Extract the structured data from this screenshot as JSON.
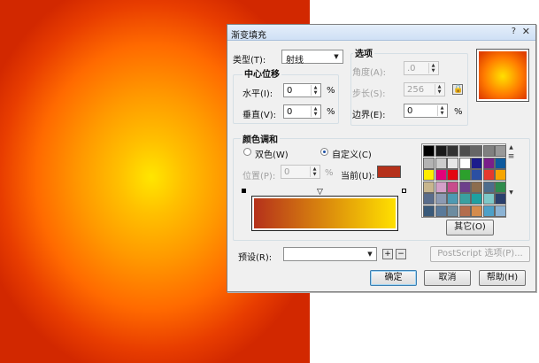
{
  "dialog": {
    "title": "渐变填充",
    "help": "?",
    "close": "✕",
    "type_label": "类型(T):",
    "type_value": "射线",
    "center_offset_label": "中心位移",
    "horizontal_label": "水平(I):",
    "horizontal_value": "0",
    "vertical_label": "垂直(V):",
    "vertical_value": "0",
    "percent": "%",
    "options_label": "选项",
    "angle_label": "角度(A):",
    "angle_value": ".0",
    "steps_label": "步长(S):",
    "steps_value": "256",
    "edge_pad_label": "边界(E):",
    "edge_pad_value": "0",
    "blend_label": "颜色调和",
    "two_color_label": "双色(W)",
    "custom_label": "自定义(C)",
    "position_label": "位置(P):",
    "position_value": "0",
    "current_label": "当前(U):",
    "current_color": "#b5311b",
    "others_button": "其它(O)",
    "presets_label": "预设(R):",
    "presets_value": "",
    "add_preset": "+",
    "remove_preset": "−",
    "postscript_button": "PostScript 选项(P)...",
    "ok_button": "确定",
    "cancel_button": "取消",
    "help_button": "帮助(H)"
  },
  "gradient": {
    "start_color": "#b5311b",
    "end_color": "#ffe000",
    "center_color": "#ffe600",
    "edge_color": "#d22800"
  },
  "palette_colors": [
    "#000000",
    "#1a1a1a",
    "#333333",
    "#4d4d4d",
    "#666666",
    "#808080",
    "#999999",
    "#b3b3b3",
    "#cccccc",
    "#e6e6e6",
    "#ffffff",
    "#1c1c8c",
    "#7a1f8a",
    "#0d5a9e",
    "#ffed00",
    "#e2007a",
    "#e30613",
    "#2ca02c",
    "#2b4fa3",
    "#e63a2e",
    "#f7a600",
    "#c8b68e",
    "#d4a0c8",
    "#c84b8c",
    "#6d3f8b",
    "#8c6d4d",
    "#4d6d8c",
    "#2f8c4d",
    "#5a6d8c",
    "#8c9ab3",
    "#4d9ab3",
    "#3aa0a0",
    "#1ea0a0",
    "#7dc8c8",
    "#2a3f6d",
    "#3a5a7a",
    "#5a7a9a",
    "#6d8ca0",
    "#b36d4d",
    "#d48c4d",
    "#4da0c8",
    "#8cb3d4"
  ]
}
